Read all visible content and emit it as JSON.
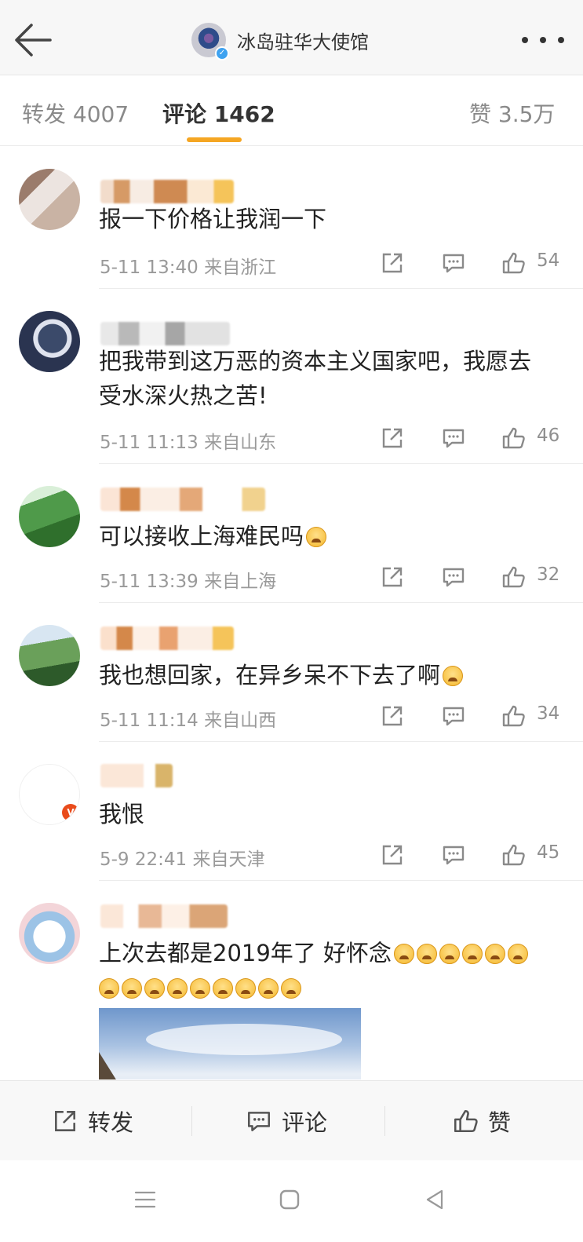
{
  "header": {
    "title": "冰岛驻华大使馆"
  },
  "tabs": [
    {
      "label": "转发 4007"
    },
    {
      "label": "评论 1462"
    },
    {
      "label": "赞 3.5万"
    }
  ],
  "comments": [
    {
      "text": "报一下价格让我润一下",
      "time": "5-11 13:40",
      "location": "来自浙江",
      "likes": "54"
    },
    {
      "text_line1": "把我带到这万恶的资本主义国家吧，我愿去",
      "text_line2": "受水深火热之苦!",
      "time": "5-11 11:13",
      "location": "来自山东",
      "likes": "46"
    },
    {
      "text": "可以接收上海难民吗",
      "time": "5-11 13:39",
      "location": "来自上海",
      "likes": "32"
    },
    {
      "text": "我也想回家，在异乡呆不下去了啊",
      "time": "5-11 11:14",
      "location": "来自山西",
      "likes": "34"
    },
    {
      "text": "我恨",
      "time": "5-9 22:41",
      "location": "来自天津",
      "likes": "45"
    },
    {
      "text": "上次去都是2019年了 好怀念"
    }
  ],
  "bottom_bar": {
    "repost": "转发",
    "comment": "评论",
    "like": "赞"
  },
  "colors": {
    "accent": "#f5a623",
    "verified": "#3ea2f0",
    "vip": "#e94b1b"
  },
  "icons": [
    "back-arrow-icon",
    "more-dots-icon",
    "share-icon",
    "comment-icon",
    "thumbs-up-icon",
    "menu-icon",
    "home-icon",
    "back-triangle-icon",
    "cry-emoji"
  ]
}
